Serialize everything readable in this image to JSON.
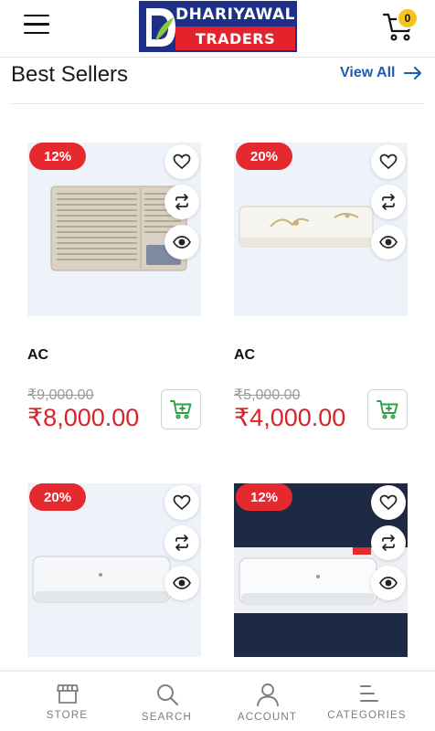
{
  "header": {
    "logo_top": "DHARIYAWAL",
    "logo_bottom": "TRADERS",
    "cart_count": "0"
  },
  "section": {
    "title": "Best Sellers",
    "view_all": "View All"
  },
  "products": [
    {
      "name": "AC",
      "discount": "12%",
      "old_price": "₹9,000.00",
      "new_price": "₹8,000.00",
      "image": "window-ac"
    },
    {
      "name": "AC",
      "discount": "20%",
      "old_price": "₹5,000.00",
      "new_price": "₹4,000.00",
      "image": "split-ac-floral"
    },
    {
      "discount": "20%",
      "image": "split-ac-white"
    },
    {
      "discount": "12%",
      "image": "split-ac-dark-background"
    }
  ],
  "bottom_nav": [
    {
      "label": "STORE",
      "icon": "store-icon"
    },
    {
      "label": "SEARCH",
      "icon": "search-icon"
    },
    {
      "label": "ACCOUNT",
      "icon": "account-icon"
    },
    {
      "label": "CATEGORIES",
      "icon": "categories-icon"
    }
  ],
  "colors": {
    "brand_blue": "#1d2f86",
    "brand_red": "#e3222c",
    "discount_red": "#e52a2f",
    "price_red": "#d8232a",
    "link_blue": "#1e5bb5",
    "cart_green": "#2e9e47",
    "badge_yellow": "#f4c419"
  }
}
